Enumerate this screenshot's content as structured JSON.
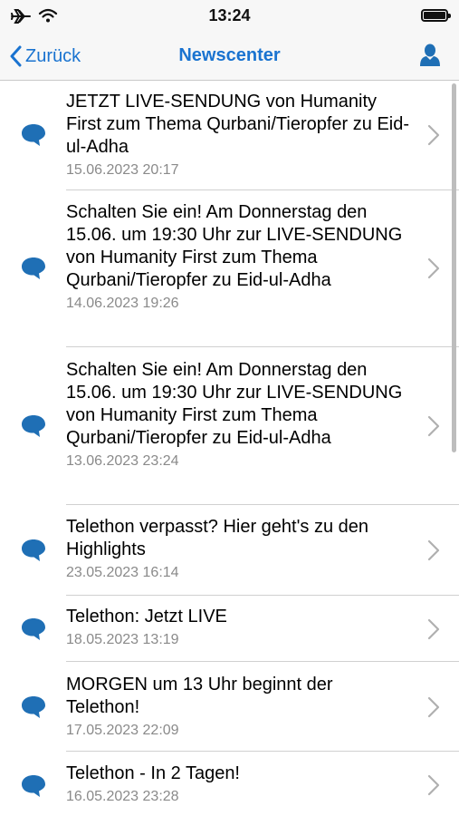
{
  "status_bar": {
    "time": "13:24"
  },
  "nav": {
    "back_label": "Zurück",
    "title": "Newscenter"
  },
  "news": [
    {
      "title": "JETZT LIVE-SENDUNG von Humanity First zum Thema Qurbani/Tieropfer zu Eid-ul-Adha",
      "date": "15.06.2023 20:17"
    },
    {
      "title": "Schalten Sie ein! Am Donnerstag den 15.06. um 19:30 Uhr zur LIVE-SENDUNG von Humanity First zum Thema Qurbani/Tieropfer zu Eid-ul-Adha",
      "date": "14.06.2023 19:26"
    },
    {
      "title": "Schalten Sie ein! Am Donnerstag den 15.06. um 19:30 Uhr zur LIVE-SENDUNG von Humanity First zum Thema Qurbani/Tieropfer zu Eid-ul-Adha",
      "date": "13.06.2023 23:24"
    },
    {
      "title": "Telethon verpasst? Hier geht's zu den Highlights",
      "date": "23.05.2023 16:14"
    },
    {
      "title": "Telethon: Jetzt LIVE",
      "date": "18.05.2023 13:19"
    },
    {
      "title": "MORGEN um 13 Uhr beginnt der Telethon!",
      "date": "17.05.2023 22:09"
    },
    {
      "title": "Telethon - In 2 Tagen!",
      "date": "16.05.2023 23:28"
    }
  ],
  "colors": {
    "accent": "#1a73d0",
    "icon_blue": "#1f6fb5",
    "date_gray": "#8a8a8a"
  },
  "icons": {
    "list_item": "speech-bubble-icon",
    "disclosure": "chevron-right-icon",
    "profile": "person-icon"
  }
}
